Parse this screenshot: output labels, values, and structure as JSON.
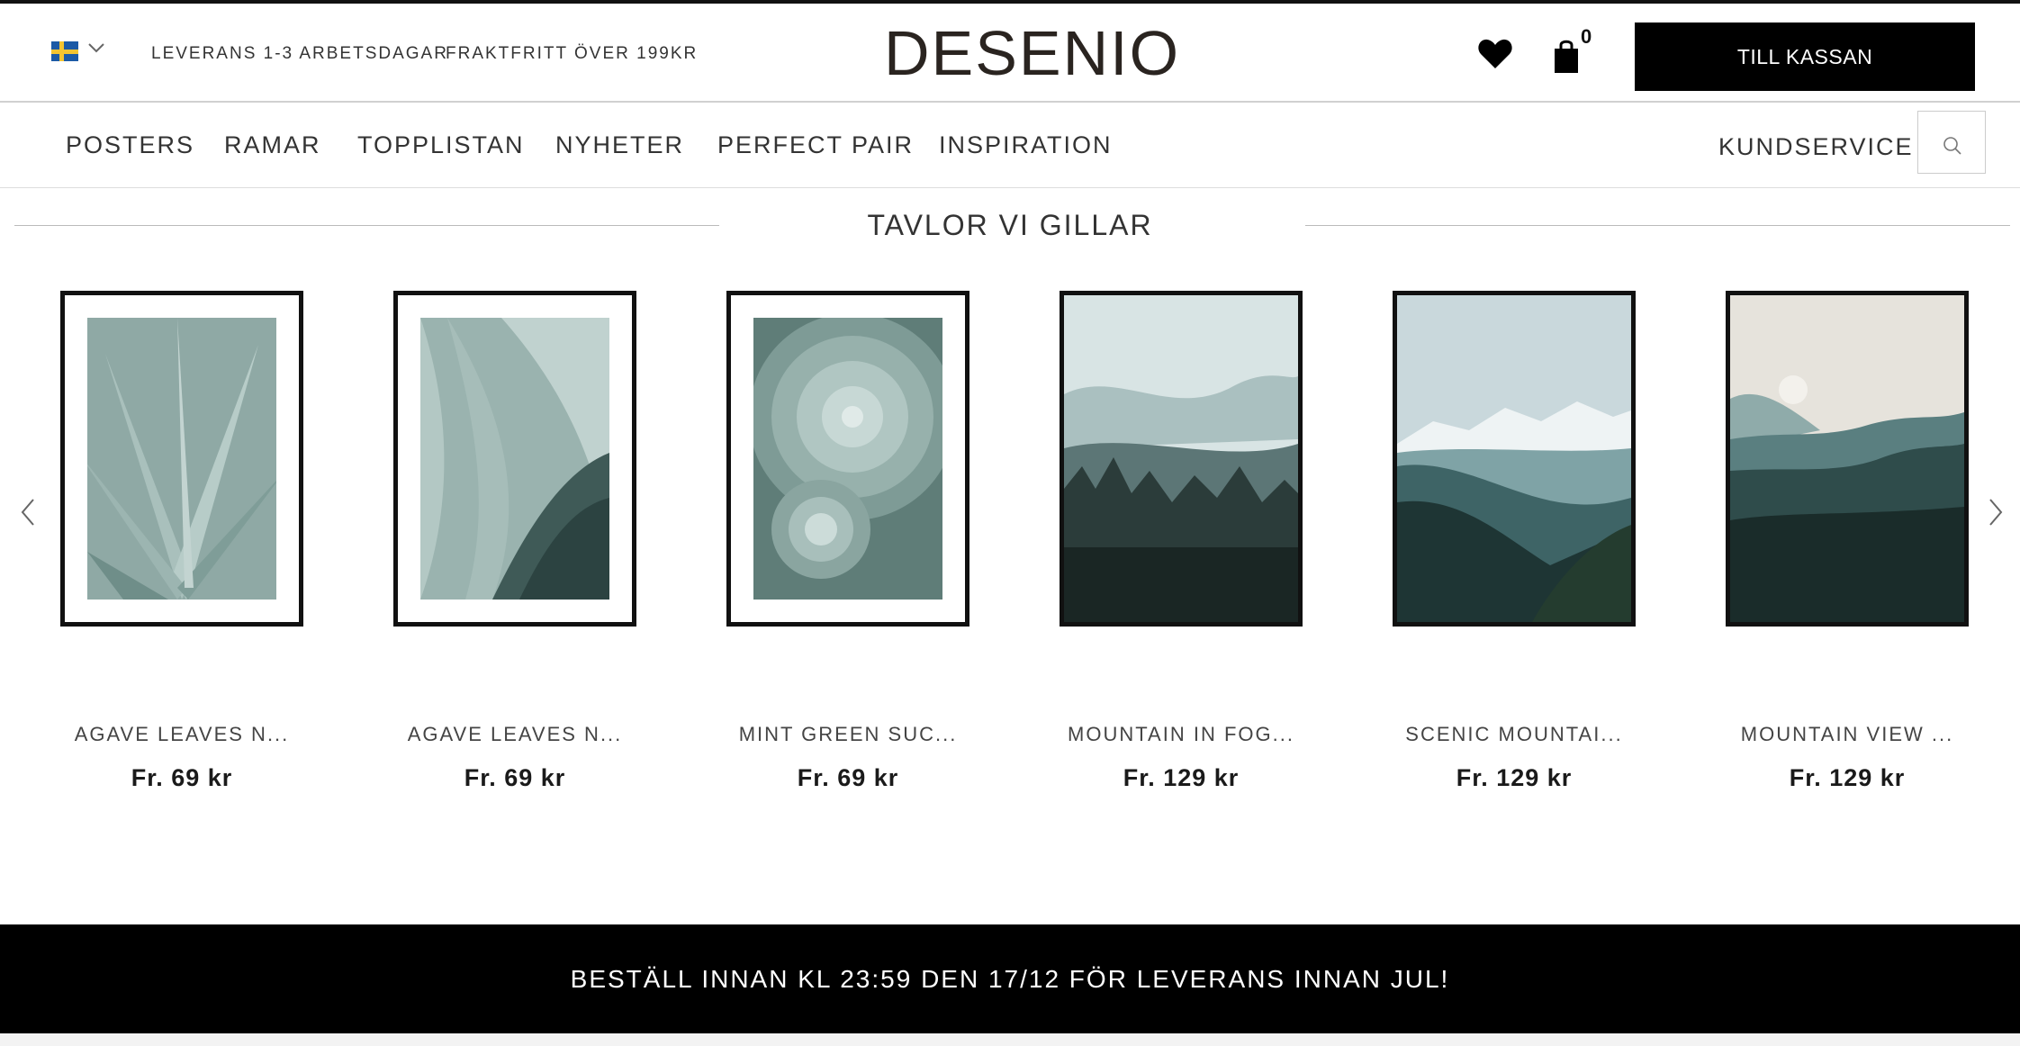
{
  "header": {
    "delivery_text": "LEVERANS 1-3 ARBETSDAGAR",
    "shipping_text": "FRAKTFRITT ÖVER 199KR",
    "logo_text": "DESENIO",
    "cart_count": "0",
    "checkout_label": "TILL KASSAN",
    "icons": {
      "flag": "sweden-flag-icon",
      "language_chevron": "chevron-down-icon",
      "wishlist": "heart-icon",
      "cart": "shopping-bag-icon"
    }
  },
  "nav": {
    "items": [
      "POSTERS",
      "RAMAR",
      "TOPPLISTAN",
      "NYHETER",
      "PERFECT PAIR",
      "INSPIRATION"
    ],
    "customer_service": "KUNDSERVICE",
    "search_icon": "search-icon"
  },
  "section": {
    "title": "TAVLOR VI GILLAR",
    "prev_icon": "chevron-left-icon",
    "next_icon": "chevron-right-icon"
  },
  "products": [
    {
      "name": "AGAVE LEAVES N...",
      "price": "Fr. 69 kr"
    },
    {
      "name": "AGAVE LEAVES N...",
      "price": "Fr. 69 kr"
    },
    {
      "name": "MINT GREEN SUC...",
      "price": "Fr. 69 kr"
    },
    {
      "name": "MOUNTAIN IN FOG...",
      "price": "Fr. 129 kr"
    },
    {
      "name": "SCENIC MOUNTAI...",
      "price": "Fr. 129 kr"
    },
    {
      "name": "MOUNTAIN VIEW ...",
      "price": "Fr. 129 kr"
    }
  ],
  "banner": {
    "text": "BESTÄLL INNAN KL 23:59 DEN 17/12 FÖR LEVERANS INNAN JUL!"
  },
  "colors": {
    "checkout_bg": "#000000",
    "banner_bg": "#000000",
    "logo": "#2a2420",
    "frame": "#111111"
  }
}
